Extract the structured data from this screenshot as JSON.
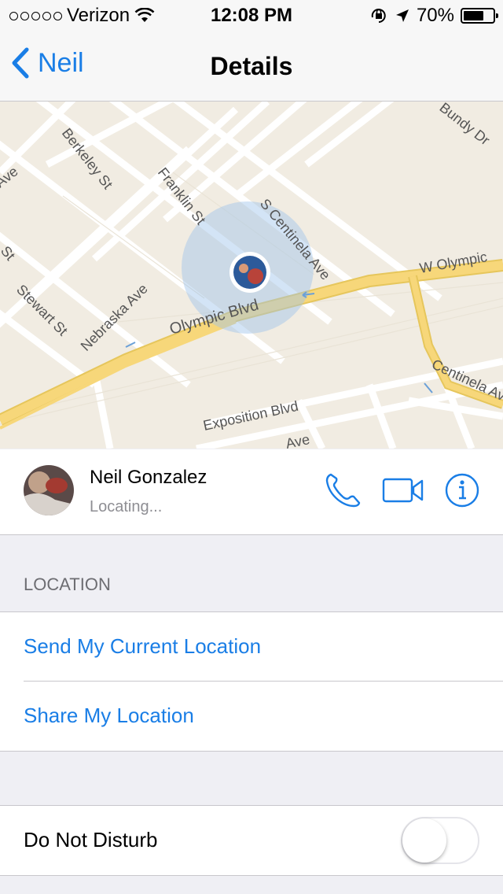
{
  "status_bar": {
    "carrier": "Verizon",
    "time": "12:08 PM",
    "battery": "70%",
    "battery_level": 0.7,
    "icons": [
      "signal-dots-icon",
      "wifi-icon",
      "rotation-lock-icon",
      "location-arrow-icon",
      "battery-icon"
    ]
  },
  "nav": {
    "back_label": "Neil",
    "title": "Details"
  },
  "map": {
    "street_labels": [
      "Bundy Dr",
      "Ave",
      "Berkeley St",
      "Franklin St",
      "S Centinela Ave",
      "W Olympic",
      "St",
      "Stewart St",
      "Nebraska Ave",
      "Olympic Blvd",
      "Centinela Ave",
      "Exposition Blvd",
      "Ave"
    ]
  },
  "contact": {
    "name": "Neil Gonzalez",
    "status": "Locating...",
    "actions": [
      "phone-icon",
      "video-icon",
      "info-icon"
    ]
  },
  "location_section": {
    "header": "LOCATION",
    "send_current": "Send My Current Location",
    "share": "Share My Location"
  },
  "dnd": {
    "label": "Do Not Disturb",
    "enabled": false
  },
  "colors": {
    "accent": "#1a7ee6",
    "group_bg": "#efeff4",
    "separator": "#c8c7cc",
    "map_bg": "#f1ece2",
    "road_major": "#f7d77a"
  }
}
